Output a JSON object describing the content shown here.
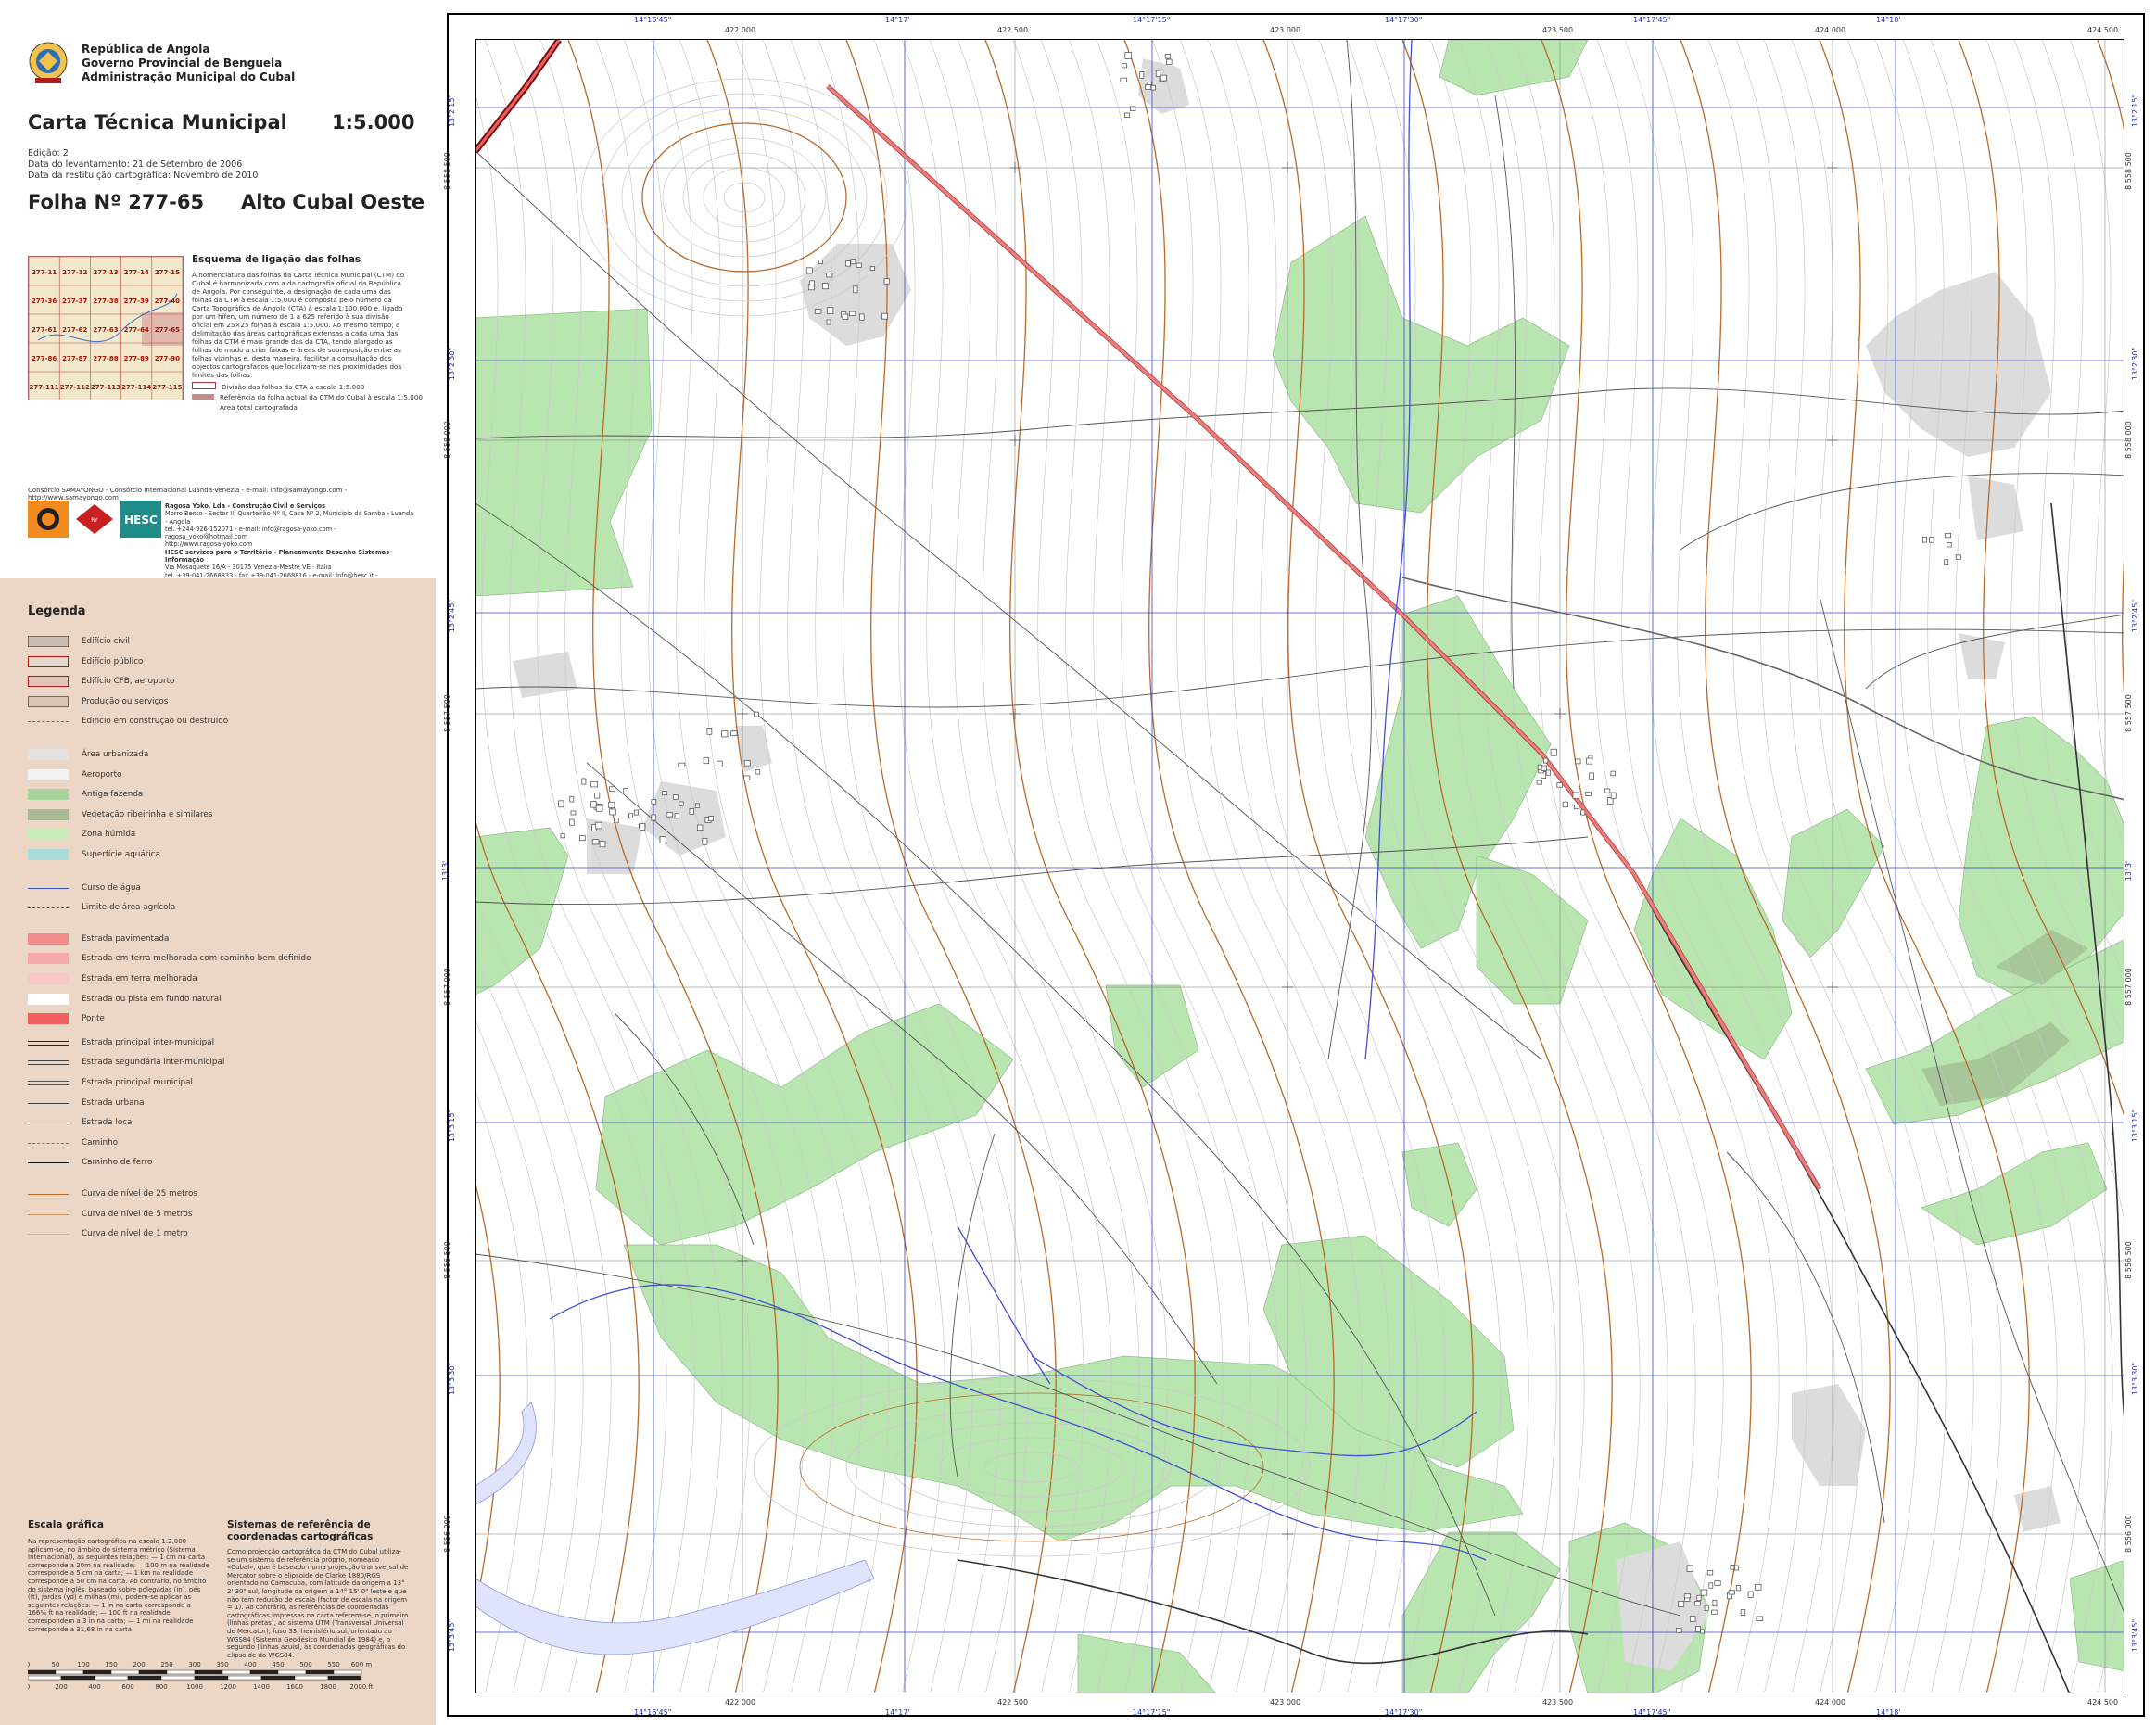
{
  "header": {
    "org_lines": [
      "República de Angola",
      "Governo Provincial de Benguela",
      "Administração Municipal do Cubal"
    ],
    "title": "Carta Técnica Municipal",
    "scale": "1:5.000",
    "edition": "Edição: 2",
    "survey_date": "Data do levantamento: 21 de Setembro de 2006",
    "restitution_date": "Data da restituição cartográfica: Novembro de 2010",
    "sheet_label": "Folha Nº  277-65",
    "sheet_name": "Alto Cubal Oeste"
  },
  "index_map": {
    "title": "Esquema de ligação das folhas",
    "text": "A nomenclatura das folhas da Carta Técnica Municipal (CTM) do Cubal é harmonizada com a da cartografia oficial da República de Angola. Por conseguinte, a designação de cada uma das folhas da CTM à escala 1:5.000 é composta pelo número da Carta Topográfica de Angola (CTA) à escala 1:100.000 e, ligado por um hífen, um número de 1 a 625 referido à sua divisão oficial em 25×25 folhas à escala 1:5.000. Ao mesmo tempo, a delimitação das áreas cartográficas extensas a cada uma das folhas da CTM é mais grande das da CTA, tendo alargado as folhas de modo a criar faixas e áreas de sobreposição entre as folhas vizinhas e, desta maneira, facilitar a consultação dos objectos cartografados que localizam-se nas proximidades dos limites das folhas.",
    "legend": [
      "Divisão das folhas da CTA à escala 1:5.000",
      "Referência da folha actual da CTM do Cubal à escala 1:5.000",
      "Área total cartografada"
    ],
    "cells": [
      "277-11",
      "277-12",
      "277-13",
      "277-14",
      "277-15",
      "277-36",
      "277-37",
      "277-38",
      "277-39",
      "277-40",
      "277-61",
      "277-62",
      "277-63",
      "277-64",
      "277-65",
      "277-86",
      "277-87",
      "277-88",
      "277-89",
      "277-90",
      "277-111",
      "277-112",
      "277-113",
      "277-114",
      "277-115"
    ]
  },
  "consortium": {
    "line": "Consórcio SAMAYONGO - Consórcio Internacional Luanda-Venezia - e-mail: info@samayongo.com - http://www.samayongo.com",
    "contact": [
      "Ragosa Yoko, Lda - Construção Civil e Serviços",
      "Morro Bento - Sector II, Quarteirão Nº II, Casa Nº 2, Município da Samba - Luanda - Angola",
      "tel. +244-926-152071 - e-mail: info@ragosa-yoko.com - ragosa_yoko@hotmail.com",
      "http://www.ragosa-yoko.com",
      "HESC servizos para o Território - Planeamento Desenho Sistemas Informação",
      "Via Mosaquete 16/A - 30175 Venezia-Mestre VE - Itália",
      "tel. +39-041-2668833 - fax +39-041-2668816 - e-mail: info@hesc.it - http://www.hesc.it"
    ],
    "logos": [
      "SAMAYONGO",
      "RAGOSA YOKO",
      "HESC"
    ]
  },
  "legend": {
    "title": "Legenda",
    "items": [
      {
        "label": "Edifício civil",
        "style": "fill",
        "color": "#c9bcb2",
        "border": "#7a6a5e"
      },
      {
        "label": "Edifício público",
        "style": "fill",
        "color": "#e8d8cc",
        "border": "#b11b1b"
      },
      {
        "label": "Edifício CFB, aeroporto",
        "style": "fill",
        "color": "#e3c4b8",
        "border": "#b11b1b"
      },
      {
        "label": "Produção ou serviços",
        "style": "fill",
        "color": "#d8c6b4",
        "border": "#7a6a5e"
      },
      {
        "label": "Edifício em construção ou destruído",
        "style": "dash",
        "color": "#7a6a5e"
      },
      {
        "label": "Área urbanizada",
        "style": "fill",
        "color": "#e1e1e1",
        "border": "none"
      },
      {
        "label": "Aeroporto",
        "style": "fill",
        "color": "#f2f2f2",
        "border": "none"
      },
      {
        "label": "Antiga fazenda",
        "style": "fill",
        "color": "#a7d49c",
        "border": "none"
      },
      {
        "label": "Vegetação ribeirinha e similares",
        "style": "fill",
        "color": "#a9b992",
        "border": "none"
      },
      {
        "label": "Zona húmida",
        "style": "fill",
        "color": "#c8ecb8",
        "border": "none"
      },
      {
        "label": "Superfície aquática",
        "style": "fill",
        "color": "#a8dcdb",
        "border": "none"
      },
      {
        "label": "Curso de água",
        "style": "line",
        "color": "#3b4fd8"
      },
      {
        "label": "Limite de área agrícola",
        "style": "dash",
        "color": "#555555"
      },
      {
        "label": "Estrada pavimentada",
        "style": "fill",
        "color": "#f28b8b",
        "border": "none"
      },
      {
        "label": "Estrada em terra melhorada com caminho bem definido",
        "style": "fill",
        "color": "#f6a9a9",
        "border": "none"
      },
      {
        "label": "Estrada em terra melhorada",
        "style": "fill",
        "color": "#f7c6c6",
        "border": "none"
      },
      {
        "label": "Estrada ou pista em fundo natural",
        "style": "fill",
        "color": "#ffffff",
        "border": "none"
      },
      {
        "label": "Ponte",
        "style": "fill",
        "color": "#ef6060",
        "border": "none"
      },
      {
        "label": "Estrada principal inter-municipal",
        "style": "double",
        "color": "#222222"
      },
      {
        "label": "Estrada segundária inter-municipal",
        "style": "double",
        "color": "#444444"
      },
      {
        "label": "Estrada principal municipal",
        "style": "double",
        "color": "#555555"
      },
      {
        "label": "Estrada urbana",
        "style": "line",
        "color": "#444444"
      },
      {
        "label": "Estrada local",
        "style": "line",
        "color": "#666666"
      },
      {
        "label": "Caminho",
        "style": "dash",
        "color": "#777777"
      },
      {
        "label": "Caminho de ferro",
        "style": "line",
        "color": "#111111"
      },
      {
        "label": "Curva de nível de 25 metros",
        "style": "line",
        "color": "#b96a2a"
      },
      {
        "label": "Curva de nível de 5 metros",
        "style": "line",
        "color": "#c7935e"
      },
      {
        "label": "Curva de nível de 1 metro",
        "style": "line",
        "color": "#b9b9b9"
      }
    ]
  },
  "scale_section": {
    "title": "Escala gráfica",
    "text": "Na representação cartográfica na escala 1:2.000 aplicam-se, no âmbito do sistema métrico (Sistema Internacional), as seguintes relações: — 1 cm na carta corresponde a 20m na realidade; — 100 m na realidade corresponde a 5 cm na carta; — 1 km na realidade corresponde a 50 cm na carta. Ao contrário, no âmbito do sistema inglês, baseado sobre polegadas (in), pés (ft), jardas (yd) e milhas (mi), podem-se aplicar as seguintes relações: — 1 in na carta corresponde a 166⅔ ft na realidade; — 100 ft na realidade correspondem a 3 in na carta; — 1 mi na realidade corresponde a 31,68 in na carta.",
    "metric_ticks": [
      "0",
      "50",
      "100",
      "150",
      "200",
      "250",
      "300",
      "350",
      "400",
      "450",
      "500",
      "550",
      "600 m"
    ],
    "feet_ticks": [
      "0",
      "200",
      "400",
      "600",
      "800",
      "1000",
      "1200",
      "1400",
      "1600",
      "1800",
      "2000 ft"
    ]
  },
  "coord_section": {
    "title": "Sistemas de referência de coordenadas cartográficas",
    "text": "Como projecção cartográfica da CTM do Cubal utiliza-se um sistema de referência próprio, nomeado «Cubal», que é baseado numa projecção transversal de Mercator sobre o elipsoide de Clarke 1880/RGS orientado no Camacupa, com latitude da origem a 13° 2' 30\" sul, longitude da origem a 14° 15' 0\" leste e que não tem redução de escala (factor de escala na origem = 1). Ao contrário, as referências de coordenadas cartográficas impressas na carta referem-se, o primeiro (linhas pretas), ao sistema UTM (Transversal Universal de Mercator), fuso 33, hemisfério sul, orientado ao WGS84 (Sistema Geodésico Mundial de 1984) e, o segundo (linhas azuis), às coordenadas geográficas do elipsoide do WGS84."
  },
  "map": {
    "top_geo": [
      "14°16'45\"",
      "14°17'",
      "14°17'15\"",
      "14°17'30\"",
      "14°17'45\"",
      "14°18'"
    ],
    "top_utm": [
      "422 000",
      "422 500",
      "423 000",
      "423 500",
      "424 000",
      "424 500"
    ],
    "bottom_geo": [
      "14°16'45\"",
      "14°17'",
      "14°17'15\"",
      "14°17'30\"",
      "14°17'45\"",
      "14°18'"
    ],
    "bottom_utm": [
      "422 000",
      "422 500",
      "423 000",
      "423 500",
      "424 000",
      "424 500"
    ],
    "left_utm": [
      "8 558 500",
      "8 558 000",
      "8 557 500",
      "8 557 000",
      "8 556 500",
      "8 556 000"
    ],
    "left_geo": [
      "13°2'15\"",
      "13°2'30\"",
      "13°2'45\"",
      "13°3'",
      "13°3'15\"",
      "13°3'30\"",
      "13°3'45\""
    ],
    "right_utm": [
      "8 558 500",
      "8 558 000",
      "8 557 500",
      "8 557 000",
      "8 556 500",
      "8 556 000"
    ],
    "right_geo": [
      "13°2'15\"",
      "13°2'30\"",
      "13°2'45\"",
      "13°3'",
      "13°3'15\"",
      "13°3'30\"",
      "13°3'45\""
    ],
    "colors": {
      "utm_grid": "#777777",
      "geo_grid": "#3b44d0",
      "contour_major": "#b96a2a",
      "contour_minor": "#c9c9c9",
      "vegetation": "#b9e6b0",
      "urban": "#dcdcdc",
      "road": "#ee7f7f",
      "river": "#4452cf"
    }
  }
}
